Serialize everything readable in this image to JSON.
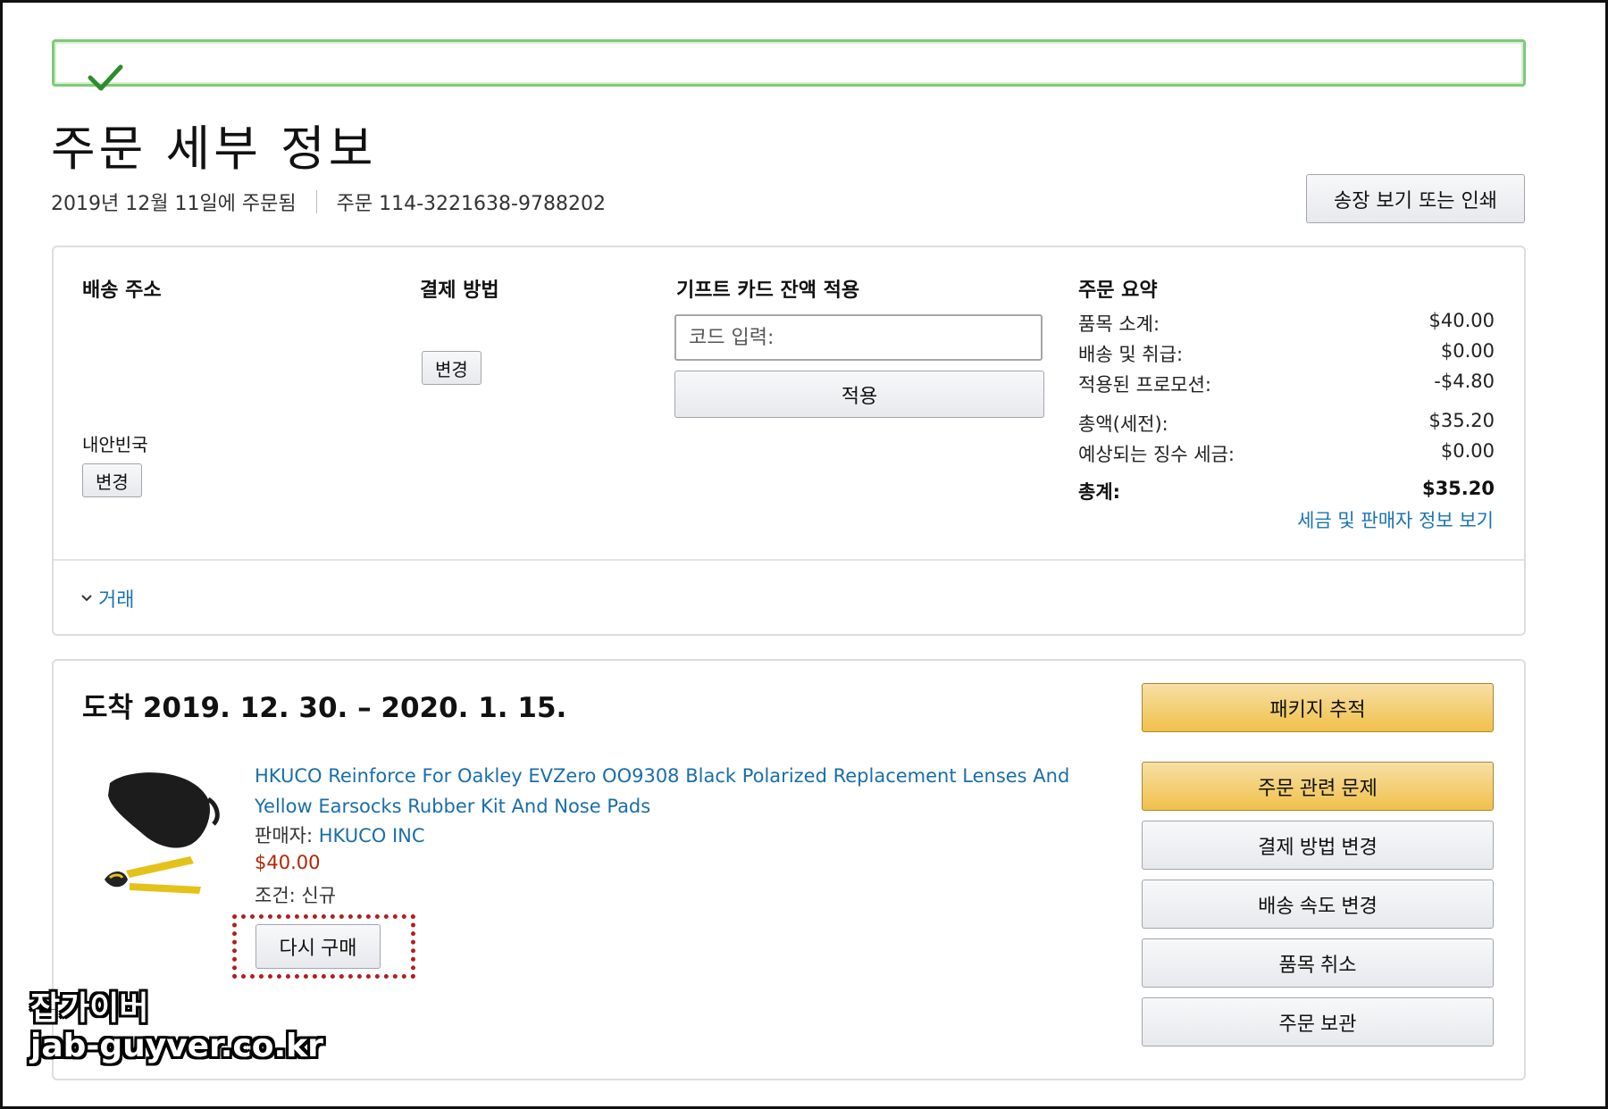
{
  "alert": {
    "icon": "check-icon",
    "color": "#7fc97a"
  },
  "page_title": "주문 세부 정보",
  "order_meta": {
    "ordered_date": "2019년 12월 11일에 주문됨",
    "order_number": "주문 114-3221638-9788202"
  },
  "invoice_button": "송장 보기 또는 인쇄",
  "shipping": {
    "heading": "배송 주소",
    "address_line": "내안빈국",
    "change_label": "변경"
  },
  "payment": {
    "heading": "결제 방법",
    "change_label": "변경"
  },
  "gift_card": {
    "heading": "기프트 카드 잔액 적용",
    "placeholder": "코드 입력:",
    "apply_label": "적용"
  },
  "order_summary": {
    "heading": "주문 요약",
    "rows": [
      {
        "label": "품목 소계:",
        "value": "$40.00"
      },
      {
        "label": "배송 및 취급:",
        "value": "$0.00"
      },
      {
        "label": "적용된 프로모션:",
        "value": "-$4.80"
      },
      {
        "label": "총액(세전):",
        "value": "$35.20"
      },
      {
        "label": "예상되는 징수 세금:",
        "value": "$0.00"
      }
    ],
    "total_label": "총계:",
    "total_value": "$35.20",
    "tax_link": "세금 및 판매자 정보 보기"
  },
  "transactions_toggle": "거래",
  "shipment": {
    "arrival": "도착 2019. 12. 30. – 2020. 1. 15.",
    "product_title": "HKUCO Reinforce For Oakley EVZero OO9308 Black Polarized Replacement Lenses And Yellow Earsocks Rubber Kit And Nose Pads",
    "seller_prefix": "판매자: ",
    "seller_name": "HKUCO INC",
    "price": "$40.00",
    "condition": "조건: 신규",
    "buy_again": "다시 구매",
    "actions": {
      "track": "패키지 추적",
      "problem": "주문 관련 문제",
      "change_payment": "결제 방법 변경",
      "change_speed": "배송 속도 변경",
      "cancel": "품목 취소",
      "archive": "주문 보관"
    }
  },
  "watermark": {
    "line1": "잡가이버",
    "line2": "jab-guyver.co.kr"
  }
}
